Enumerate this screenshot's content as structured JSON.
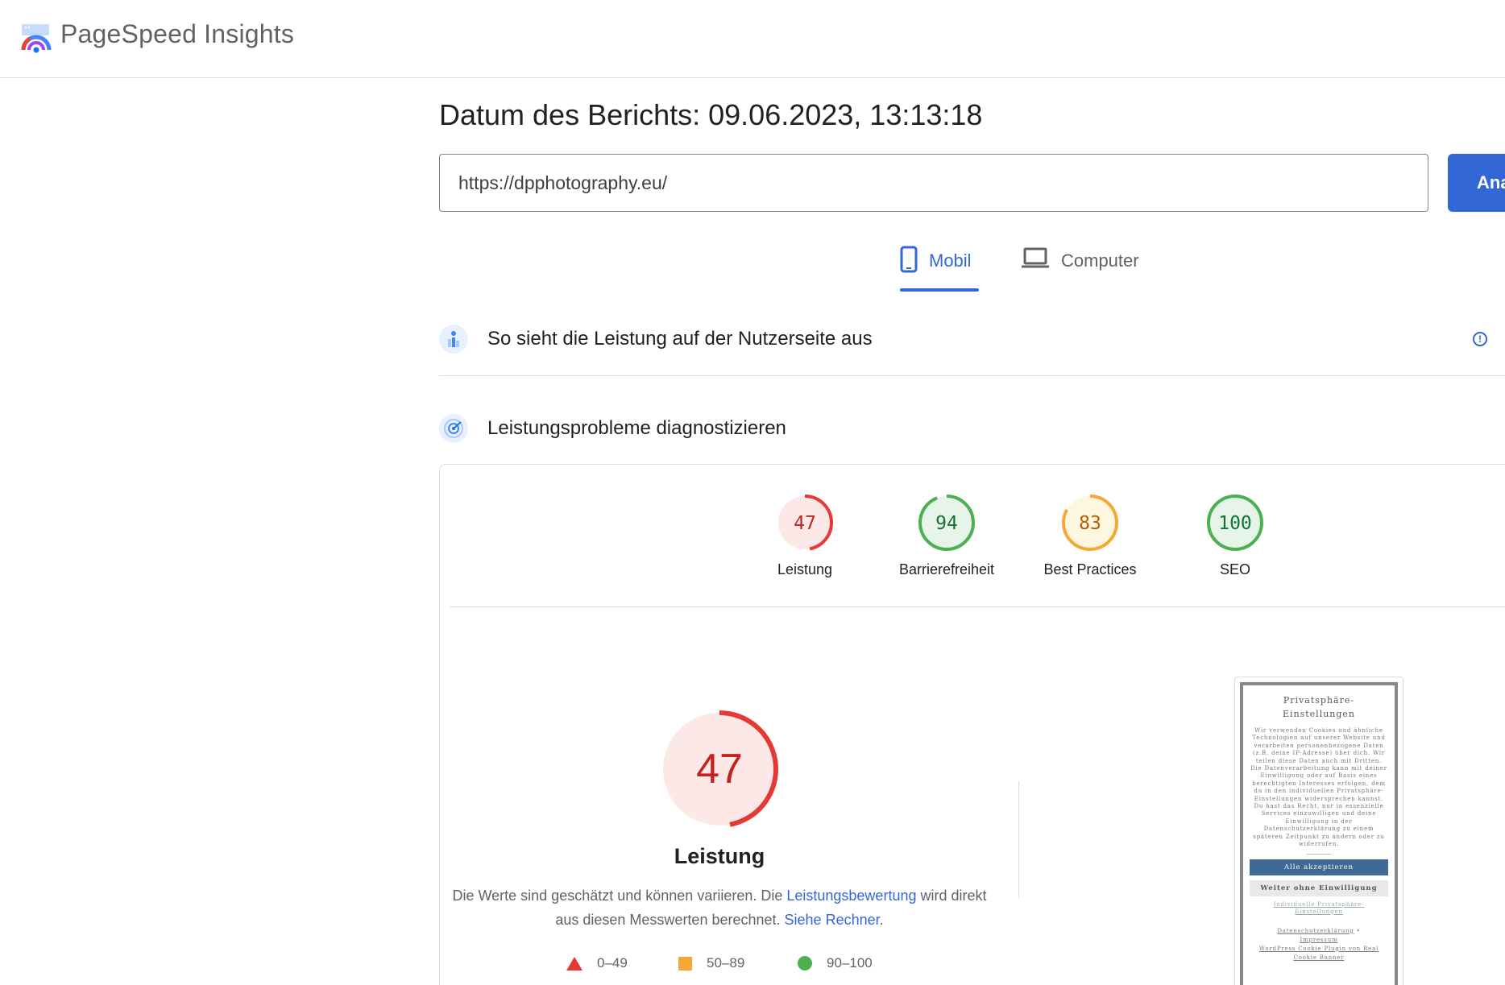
{
  "header": {
    "title": "PageSpeed Insights"
  },
  "report": {
    "date_label": "Datum des Berichts: 09.06.2023, 13:13:18"
  },
  "search": {
    "url": "https://dpphotography.eu/",
    "analyze_label": "Analysieren"
  },
  "tabs": [
    {
      "label": "Mobil",
      "active": true
    },
    {
      "label": "Computer",
      "active": false
    }
  ],
  "sections": {
    "field_data": {
      "title": "So sieht die Leistung auf der Nutzerseite aus"
    },
    "diagnose": {
      "title": "Leistungsprobleme diagnostizieren"
    }
  },
  "scores": [
    {
      "value": "47",
      "label": "Leistung",
      "color": "#e53935",
      "track": "#fce8e6",
      "text_color": "#c5221f",
      "fraction": 0.47
    },
    {
      "value": "94",
      "label": "Barrierefreiheit",
      "color": "#4caf50",
      "track": "#e6f4ea",
      "text_color": "#137333",
      "fraction": 0.94
    },
    {
      "value": "83",
      "label": "Best Practices",
      "color": "#f4a838",
      "track": "#fef7e0",
      "text_color": "#b06000",
      "fraction": 0.83
    },
    {
      "value": "100",
      "label": "SEO",
      "color": "#4caf50",
      "track": "#e6f4ea",
      "text_color": "#137333",
      "fraction": 1.0
    }
  ],
  "performance": {
    "value": "47",
    "label": "Leistung",
    "desc_prefix": "Die Werte sind geschätzt und können variieren. Die ",
    "desc_link1": "Leistungsbewertung",
    "desc_middle": " wird direkt aus diesen Messwerten berechnet. ",
    "desc_link2": "Siehe Rechner",
    "desc_suffix": "."
  },
  "legend": [
    {
      "range": "0–49",
      "color": "#e53935"
    },
    {
      "range": "50–89",
      "color": "#f4a838"
    },
    {
      "range": "90–100",
      "color": "#4caf50"
    }
  ],
  "screenshot": {
    "title": "Privatsphäre-Einstellungen",
    "body": "Wir verwenden Cookies und ähnliche Technologien auf unserer Website und verarbeiten personenbezogene Daten (z.B. deine IP-Adresse) über dich. Wir teilen diese Daten auch mit Dritten. Die Datenverarbeitung kann mit deiner Einwilligung oder auf Basis eines berechtigten Interesses erfolgen, dem du in den individuellen Privatsphäre-Einstellungen widersprechen kannst. Du hast das Recht, nur in essenzielle Services einzuwilligen und deine Einwilligung in der Datenschutzerklärung zu einem späteren Zeitpunkt zu ändern oder zu widerrufen.",
    "accept": "Alle akzeptieren",
    "deny": "Weiter ohne Einwilligung",
    "individual": "Individuelle Privatsphäre-Einstellungen",
    "privacy": "Datenschutzerklärung",
    "imprint": "Impressum",
    "plugin": "WordPress Cookie Plugin von Real Cookie Banner"
  }
}
